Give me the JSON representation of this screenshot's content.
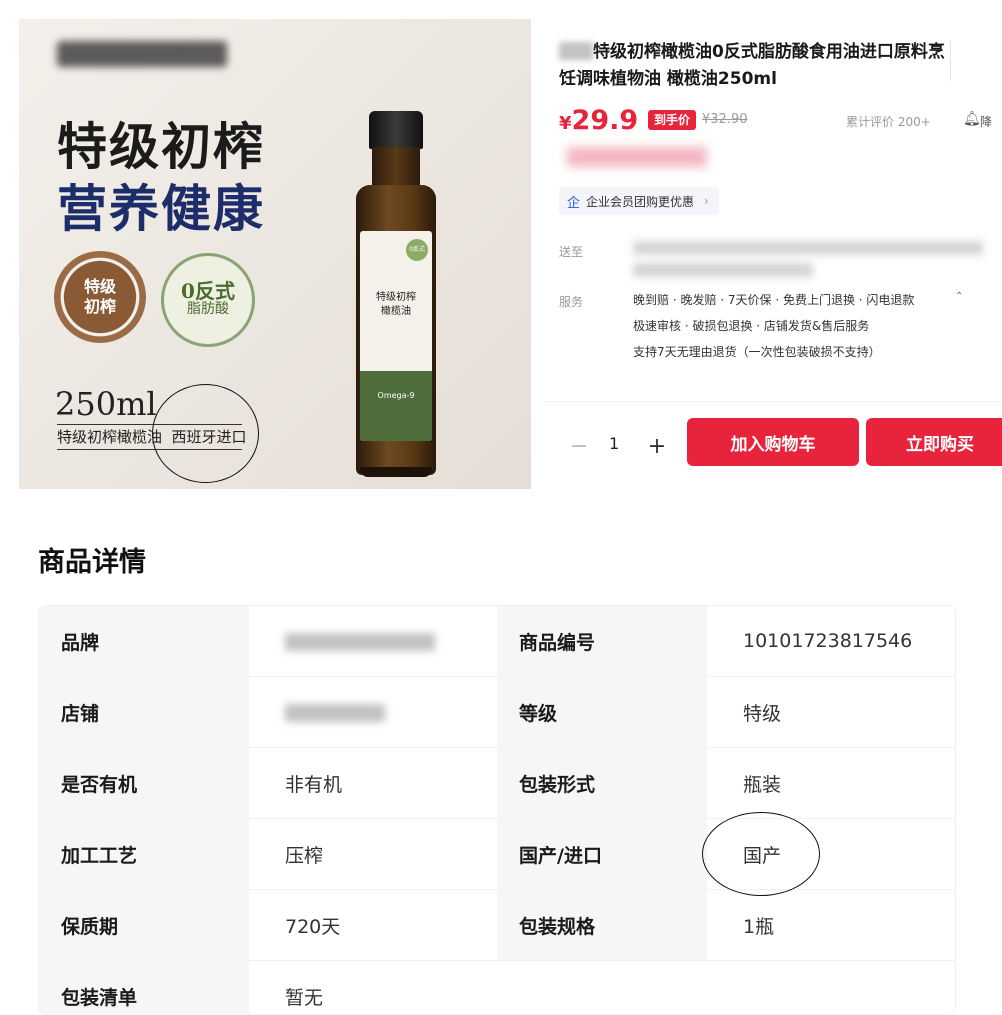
{
  "hero": {
    "headline_line1": "特级初榨",
    "headline_line2": "营养健康",
    "seal_a": "特级\n初榨",
    "seal_b_big": "0反式",
    "seal_b_small": "脂肪酸",
    "volume": "250ml",
    "sub_caption": "特级初榨橄榄油  西班牙进口",
    "bottle_label": "特级初榨\n橄榄油",
    "bottle_badge": "0反式",
    "bottle_omega": "Omega-9"
  },
  "product": {
    "title": "特级初榨橄榄油0反式脂肪酸食用油进口原料烹饪调味植物油 橄榄油250ml",
    "currency": "¥",
    "price": "29.9",
    "price_tag": "到手价",
    "original_price": "¥32.90",
    "reviews": "累计评价 200+",
    "notify_label": "降",
    "corp_offer": "企业会员团购更优惠",
    "ship_label": "送至",
    "service_label": "服务",
    "service_line1": "晚到赔 · 晚发赔 · 7天价保 · 免费上门退换 · 闪电退款",
    "service_line2": "极速审核 · 破损包退换 · 店铺发货&售后服务",
    "service_line3": "支持7天无理由退货（一次性包装破损不支持）",
    "quantity": "1",
    "add_to_cart": "加入购物车",
    "buy_now": "立即购买"
  },
  "details": {
    "title": "商品详情",
    "rows": [
      {
        "k1": "品牌",
        "v1": "",
        "k2": "商品编号",
        "v2": "10101723817546"
      },
      {
        "k1": "店铺",
        "v1": "",
        "k2": "等级",
        "v2": "特级"
      },
      {
        "k1": "是否有机",
        "v1": "非有机",
        "k2": "包装形式",
        "v2": "瓶装"
      },
      {
        "k1": "加工工艺",
        "v1": "压榨",
        "k2": "国产/进口",
        "v2": "国产"
      },
      {
        "k1": "保质期",
        "v1": "720天",
        "k2": "包装规格",
        "v2": "1瓶"
      },
      {
        "k1": "包装清单",
        "v1": "暂无",
        "k2": "",
        "v2": ""
      }
    ]
  },
  "colors": {
    "accent_red": "#e8243c",
    "navy_text": "#1c2d6a"
  }
}
